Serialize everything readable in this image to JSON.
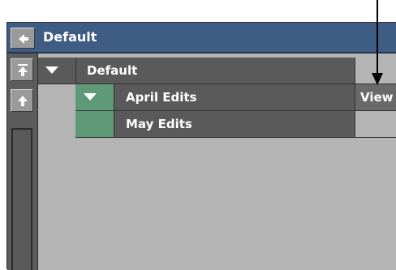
{
  "title_bar": {
    "title": "Default"
  },
  "tree": {
    "root": {
      "label": "Default"
    },
    "children": [
      {
        "label": "April Edits",
        "action": "View"
      },
      {
        "label": "May Edits",
        "action": ""
      }
    ]
  },
  "colors": {
    "title_bar": "#3f5c85",
    "row": "#5a5a5a",
    "selected_indicator": "#5f9a78",
    "panel_bg": "#b4b4b4"
  },
  "icons": {
    "back": "left-arrow-icon",
    "scroll_top": "scroll-to-top-icon",
    "scroll_up": "scroll-up-icon",
    "expand": "triangle-down-icon",
    "callout": "down-arrow-icon"
  }
}
